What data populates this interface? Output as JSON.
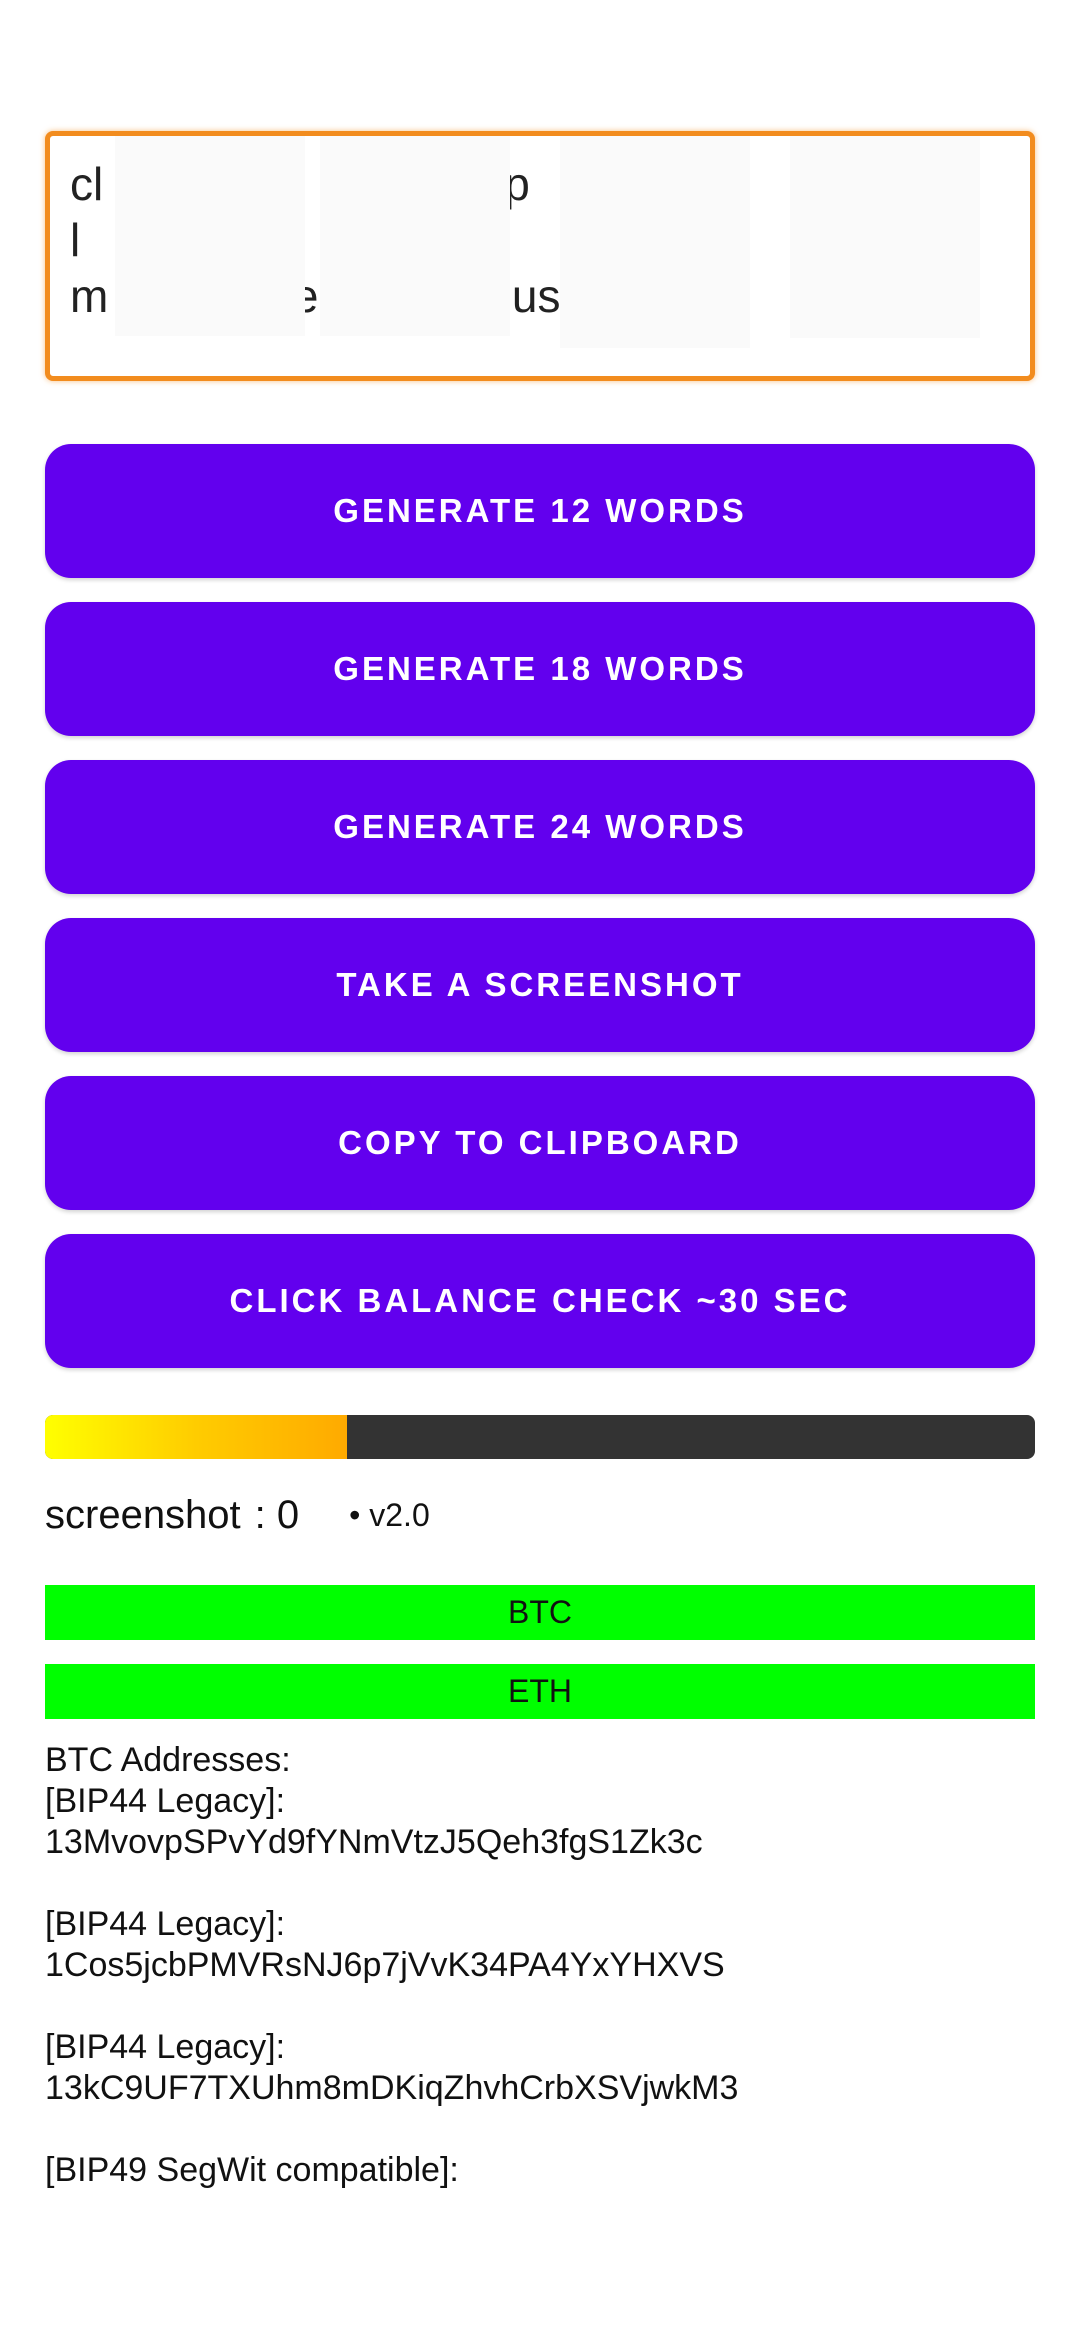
{
  "mnemonic": {
    "text": "cl          e          y p          sh                    l\nm           e          ous"
  },
  "buttons": {
    "generate_12": "GENERATE 12 WORDS",
    "generate_18": "GENERATE 18 WORDS",
    "generate_24": "GENERATE 24 WORDS",
    "screenshot": "TAKE A SCREENSHOT",
    "copy": "COPY TO CLIPBOARD",
    "balance": "CLICK BALANCE CHECK ~30 SEC"
  },
  "progress": {
    "value_fraction": 0.305
  },
  "status": {
    "screenshot_label": "screenshot",
    "screenshot_count": ": 0",
    "version": "• v2.0"
  },
  "coins": {
    "btc": "BTC",
    "eth": "ETH"
  },
  "addresses": {
    "header": "BTC Addresses:",
    "entries": [
      {
        "type": "[BIP44 Legacy]:",
        "address": "13MvovpSPvYd9fYNmVtzJ5Qeh3fgS1Zk3c"
      },
      {
        "type": "[BIP44 Legacy]:",
        "address": "1Cos5jcbPMVRsNJ6p7jVvK34PA4YxYHXVS"
      },
      {
        "type": "[BIP44 Legacy]:",
        "address": "13kC9UF7TXUhm8mDKiqZhvhCrbXSVjwkM3"
      },
      {
        "type": "[BIP49 SegWit compatible]:",
        "address": ""
      }
    ]
  },
  "colors": {
    "button_bg": "#6200ee",
    "mnemonic_border": "#f28c1e",
    "coin_bg": "#00ff00",
    "progress_track": "#333333"
  }
}
